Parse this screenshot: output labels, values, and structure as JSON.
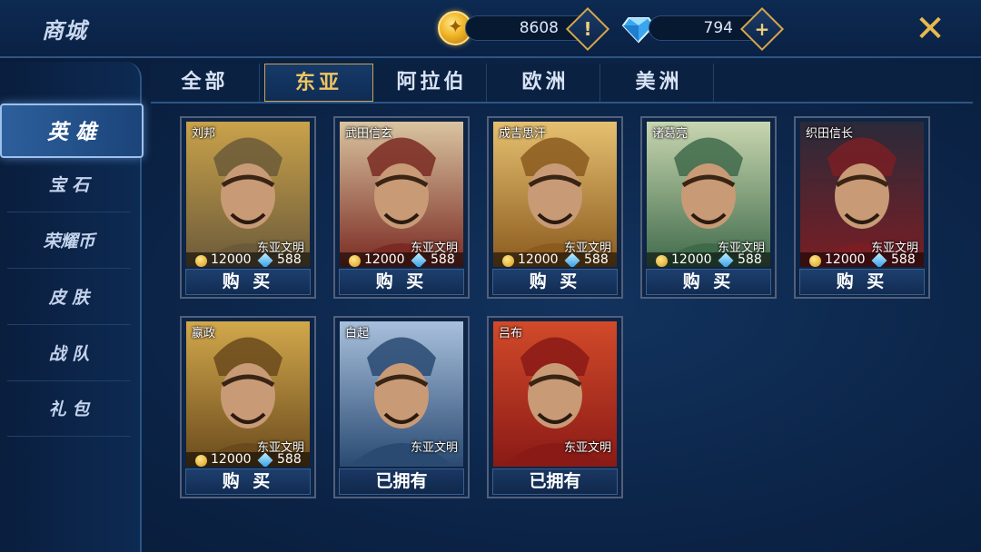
{
  "header": {
    "title": "商城"
  },
  "currency": {
    "gold": {
      "icon": "gold-coin-icon",
      "amount": "8608",
      "button_icon": "exclamation-icon",
      "button_glyph": "!"
    },
    "diamond": {
      "icon": "diamond-icon",
      "amount": "794",
      "button_icon": "plus-icon",
      "button_glyph": "+"
    }
  },
  "close": {
    "icon": "close-icon",
    "glyph": "✕"
  },
  "sidebar": {
    "items": [
      {
        "label": "英 雄",
        "active": true
      },
      {
        "label": "宝 石"
      },
      {
        "label": "荣耀币"
      },
      {
        "label": "皮 肤"
      },
      {
        "label": "战 队"
      },
      {
        "label": "礼 包"
      }
    ]
  },
  "tabs": [
    {
      "label": "全部"
    },
    {
      "label": "东亚",
      "active": true
    },
    {
      "label": "阿拉伯"
    },
    {
      "label": "欧洲"
    },
    {
      "label": "美洲"
    }
  ],
  "heroes": [
    {
      "name": "刘邦",
      "civ": "东亚文明",
      "gold_price": "12000",
      "gem_price": "588",
      "action": "购 买",
      "owned": false,
      "colors": [
        "#6b5a3a",
        "#c9a24a"
      ]
    },
    {
      "name": "武田信玄",
      "civ": "东亚文明",
      "gold_price": "12000",
      "gem_price": "588",
      "action": "购 买",
      "owned": false,
      "colors": [
        "#7a2a22",
        "#d9c4a0"
      ]
    },
    {
      "name": "成吉思汗",
      "civ": "东亚文明",
      "gold_price": "12000",
      "gem_price": "588",
      "action": "购 买",
      "owned": false,
      "colors": [
        "#8a5a1e",
        "#e6c070"
      ]
    },
    {
      "name": "诸葛亮",
      "civ": "东亚文明",
      "gold_price": "12000",
      "gem_price": "588",
      "action": "购 买",
      "owned": false,
      "colors": [
        "#3f6a4a",
        "#c8d6b0"
      ]
    },
    {
      "name": "织田信长",
      "civ": "东亚文明",
      "gold_price": "12000",
      "gem_price": "588",
      "action": "购 买",
      "owned": false,
      "colors": [
        "#7a1e24",
        "#2a2a3a"
      ]
    },
    {
      "name": "嬴政",
      "civ": "东亚文明",
      "gold_price": "12000",
      "gem_price": "588",
      "action": "购 买",
      "owned": false,
      "colors": [
        "#6a4a1c",
        "#d2a84c"
      ]
    },
    {
      "name": "白起",
      "civ": "东亚文明",
      "gold_price": "",
      "gem_price": "",
      "action": "已拥有",
      "owned": true,
      "colors": [
        "#2a4a72",
        "#a8c0dc"
      ]
    },
    {
      "name": "吕布",
      "civ": "东亚文明",
      "gold_price": "",
      "gem_price": "",
      "action": "已拥有",
      "owned": true,
      "colors": [
        "#8a1a16",
        "#d24a2a"
      ]
    }
  ]
}
